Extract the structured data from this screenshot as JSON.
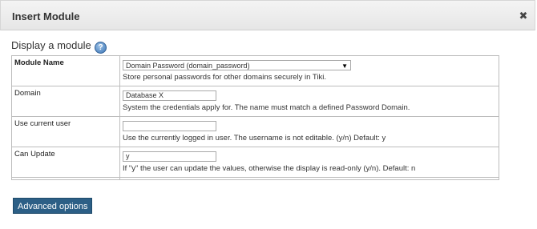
{
  "dialog": {
    "title": "Insert Module",
    "close_glyph": "✖"
  },
  "section": {
    "title": "Display a module",
    "help_icon": "?"
  },
  "fields": [
    {
      "label": "Module Name",
      "select_value": "Domain Password (domain_password)",
      "description": "Store personal passwords for other domains securely in Tiki."
    },
    {
      "label": "Domain",
      "value": "Database X",
      "description": "System the credentials apply for. The name must match a defined Password Domain."
    },
    {
      "label": "Use current user",
      "value": "",
      "description": "Use the currently logged in user. The username is not editable. (y/n) Default: y"
    },
    {
      "label": "Can Update",
      "value": "y",
      "description": "If \"y\" the user can update the values, otherwise the display is read-only (y/n). Default: n"
    }
  ],
  "buttons": {
    "advanced_options": "Advanced options"
  },
  "colors": {
    "button_bg": "#2c5f86",
    "header_bg": "#ececec"
  }
}
